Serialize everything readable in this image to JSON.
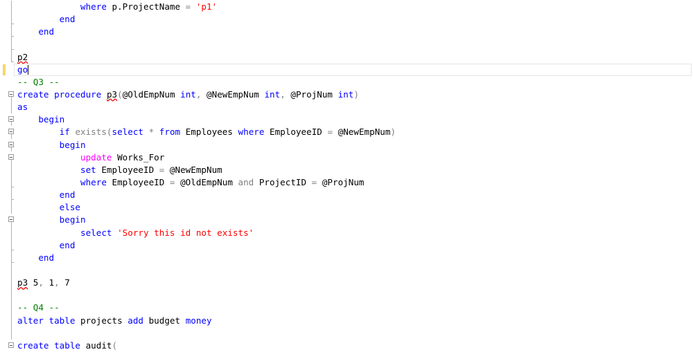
{
  "editor": {
    "colors": {
      "keyword": "#0000ff",
      "string": "#ff0000",
      "comment": "#008000",
      "operator": "#808080",
      "function": "#ff00ff"
    },
    "lines": [
      {
        "fold": "line",
        "tokens": [
          [
            "            ",
            ""
          ],
          [
            "where",
            "k"
          ],
          [
            " p.ProjectName ",
            ""
          ],
          [
            "=",
            "g"
          ],
          [
            " ",
            ""
          ],
          [
            "'p1'",
            "s"
          ]
        ]
      },
      {
        "fold": "tick",
        "tokens": [
          [
            "        ",
            ""
          ],
          [
            "end",
            "k"
          ]
        ]
      },
      {
        "fold": "tick",
        "tokens": [
          [
            "    ",
            ""
          ],
          [
            "end",
            "k"
          ]
        ]
      },
      {
        "fold": "tick",
        "tokens": []
      },
      {
        "fold": "end",
        "tokens": [
          [
            "p2",
            "sq"
          ]
        ]
      },
      {
        "fold": "",
        "current": true,
        "tokens": [
          [
            "go",
            "k"
          ]
        ]
      },
      {
        "fold": "",
        "tokens": [
          [
            "-- Q3 --",
            "c"
          ]
        ]
      },
      {
        "fold": "box",
        "tokens": [
          [
            "create",
            "k"
          ],
          [
            " ",
            ""
          ],
          [
            "procedure",
            "k"
          ],
          [
            " ",
            ""
          ],
          [
            "p3",
            "sq"
          ],
          [
            "(",
            "g"
          ],
          [
            "@OldEmpNum ",
            ""
          ],
          [
            "int",
            "k"
          ],
          [
            ", ",
            "g"
          ],
          [
            "@NewEmpNum ",
            ""
          ],
          [
            "int",
            "k"
          ],
          [
            ", ",
            "g"
          ],
          [
            "@ProjNum ",
            ""
          ],
          [
            "int",
            "k"
          ],
          [
            ")",
            "g"
          ]
        ]
      },
      {
        "fold": "line",
        "tokens": [
          [
            "as",
            "k"
          ]
        ]
      },
      {
        "fold": "box",
        "tokens": [
          [
            "    ",
            ""
          ],
          [
            "begin",
            "k"
          ]
        ]
      },
      {
        "fold": "box",
        "tokens": [
          [
            "        ",
            ""
          ],
          [
            "if",
            "k"
          ],
          [
            " ",
            ""
          ],
          [
            "exists(",
            "g"
          ],
          [
            "select",
            "k"
          ],
          [
            " ",
            ""
          ],
          [
            "*",
            "g"
          ],
          [
            " ",
            ""
          ],
          [
            "from",
            "k"
          ],
          [
            " Employees ",
            ""
          ],
          [
            "where",
            "k"
          ],
          [
            " EmployeeID ",
            ""
          ],
          [
            "=",
            "g"
          ],
          [
            " @NewEmpNum",
            ""
          ],
          [
            ")",
            "g"
          ]
        ]
      },
      {
        "fold": "box",
        "tokens": [
          [
            "        ",
            ""
          ],
          [
            "begin",
            "k"
          ]
        ]
      },
      {
        "fold": "box",
        "tokens": [
          [
            "            ",
            ""
          ],
          [
            "update",
            "m"
          ],
          [
            " Works_For",
            ""
          ]
        ]
      },
      {
        "fold": "line",
        "tokens": [
          [
            "            ",
            ""
          ],
          [
            "set",
            "k"
          ],
          [
            " EmployeeID ",
            ""
          ],
          [
            "=",
            "g"
          ],
          [
            " @NewEmpNum",
            ""
          ]
        ]
      },
      {
        "fold": "tick",
        "tokens": [
          [
            "            ",
            ""
          ],
          [
            "where",
            "k"
          ],
          [
            " EmployeeID ",
            ""
          ],
          [
            "=",
            "g"
          ],
          [
            " @OldEmpNum ",
            ""
          ],
          [
            "and",
            "g"
          ],
          [
            " ProjectID ",
            ""
          ],
          [
            "=",
            "g"
          ],
          [
            " @ProjNum",
            ""
          ]
        ]
      },
      {
        "fold": "tick",
        "tokens": [
          [
            "        ",
            ""
          ],
          [
            "end",
            "k"
          ]
        ]
      },
      {
        "fold": "line",
        "tokens": [
          [
            "        ",
            ""
          ],
          [
            "else",
            "k"
          ]
        ]
      },
      {
        "fold": "box",
        "tokens": [
          [
            "        ",
            ""
          ],
          [
            "begin",
            "k"
          ]
        ]
      },
      {
        "fold": "line",
        "tokens": [
          [
            "            ",
            ""
          ],
          [
            "select",
            "k"
          ],
          [
            " ",
            ""
          ],
          [
            "'Sorry this id not exists'",
            "s"
          ]
        ]
      },
      {
        "fold": "tick",
        "tokens": [
          [
            "        ",
            ""
          ],
          [
            "end",
            "k"
          ]
        ]
      },
      {
        "fold": "tick",
        "tokens": [
          [
            "    ",
            ""
          ],
          [
            "end",
            "k"
          ]
        ]
      },
      {
        "fold": "line",
        "tokens": []
      },
      {
        "fold": "line",
        "tokens": [
          [
            "p3",
            "sq"
          ],
          [
            " 5",
            ""
          ],
          [
            ", ",
            "g"
          ],
          [
            "1",
            ""
          ],
          [
            ", ",
            "g"
          ],
          [
            "7",
            ""
          ]
        ]
      },
      {
        "fold": "line",
        "tokens": []
      },
      {
        "fold": "line",
        "tokens": [
          [
            "-- Q4 --",
            "c"
          ]
        ]
      },
      {
        "fold": "line",
        "tokens": [
          [
            "alter",
            "k"
          ],
          [
            " ",
            ""
          ],
          [
            "table",
            "k"
          ],
          [
            " projects ",
            ""
          ],
          [
            "add",
            "k"
          ],
          [
            " budget ",
            ""
          ],
          [
            "money",
            "k"
          ]
        ]
      },
      {
        "fold": "line",
        "tokens": []
      },
      {
        "fold": "box",
        "tokens": [
          [
            "create",
            "k"
          ],
          [
            " ",
            ""
          ],
          [
            "table",
            "k"
          ],
          [
            " audit",
            ""
          ],
          [
            "(",
            "g"
          ]
        ]
      }
    ]
  }
}
